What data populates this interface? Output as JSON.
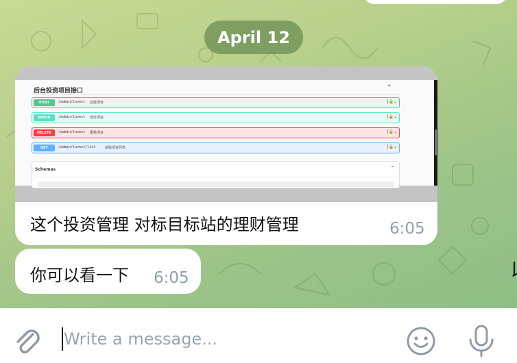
{
  "chat": {
    "date_label": "April 12",
    "clipped_right_char": "以",
    "messages": [
      {
        "text": "这个投资管理 对标目标站的理财管理",
        "time": "6:05",
        "screenshot": {
          "title": "后台投资项目接口",
          "endpoints": [
            {
              "method": "POST",
              "path": "/admin/invest",
              "desc": "创建项目"
            },
            {
              "method": "PATCH",
              "path": "/admin/invest",
              "desc": "修改项目"
            },
            {
              "method": "DELETE",
              "path": "/admin/invest",
              "desc": "删除项目"
            },
            {
              "method": "GET",
              "path": "/admin/invest/list",
              "desc": "获取项目列表"
            }
          ],
          "schemas_label": "Schemas"
        }
      },
      {
        "text": "你可以看一下",
        "time": "6:05"
      }
    ]
  },
  "composer": {
    "placeholder": "Write a message...",
    "value": "",
    "attach_icon": "paperclip-icon",
    "emoji_icon": "smiley-icon",
    "mic_icon": "microphone-icon"
  },
  "colors": {
    "accent_gray": "#8fa0ad",
    "post": "#49cc90",
    "patch": "#50e3c2",
    "delete": "#f93e3e",
    "get": "#61affe",
    "date_pill": "#6e9155"
  }
}
